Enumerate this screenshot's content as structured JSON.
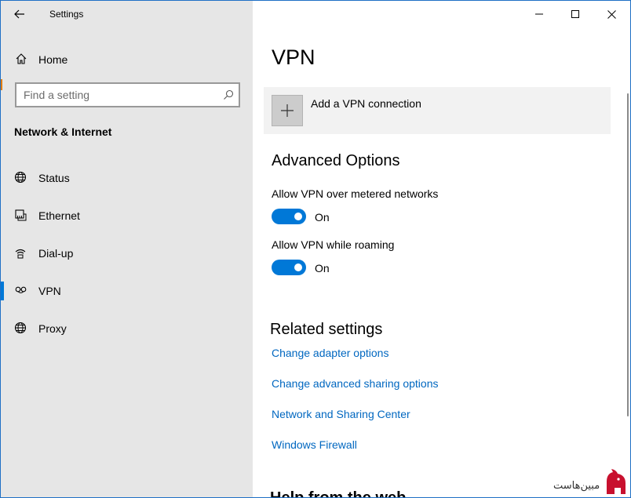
{
  "window": {
    "app_title": "Settings",
    "controls": {
      "minimize": "minimize",
      "maximize": "maximize",
      "close": "close"
    }
  },
  "sidebar": {
    "home_label": "Home",
    "search": {
      "placeholder": "Find a setting",
      "value": ""
    },
    "section_heading": "Network & Internet",
    "items": [
      {
        "label": "Status",
        "icon": "globe-status-icon",
        "selected": false
      },
      {
        "label": "Ethernet",
        "icon": "ethernet-icon",
        "selected": false
      },
      {
        "label": "Dial-up",
        "icon": "dialup-icon",
        "selected": false
      },
      {
        "label": "VPN",
        "icon": "vpn-icon",
        "selected": true
      },
      {
        "label": "Proxy",
        "icon": "globe-icon",
        "selected": false
      }
    ]
  },
  "main": {
    "title": "VPN",
    "add_vpn_label": "Add a VPN connection",
    "advanced_heading": "Advanced Options",
    "settings": [
      {
        "label": "Allow VPN over metered networks",
        "state": "On"
      },
      {
        "label": "Allow VPN while roaming",
        "state": "On"
      }
    ],
    "related_heading": "Related settings",
    "links": [
      "Change adapter options",
      "Change advanced sharing options",
      "Network and Sharing Center",
      "Windows Firewall"
    ],
    "partial_heading": "Help from the web"
  },
  "watermark": {
    "text": "مبین‌هاست"
  },
  "colors": {
    "accent": "#0078d7",
    "link": "#0067c0",
    "sidebar_bg": "#e6e6e6"
  }
}
